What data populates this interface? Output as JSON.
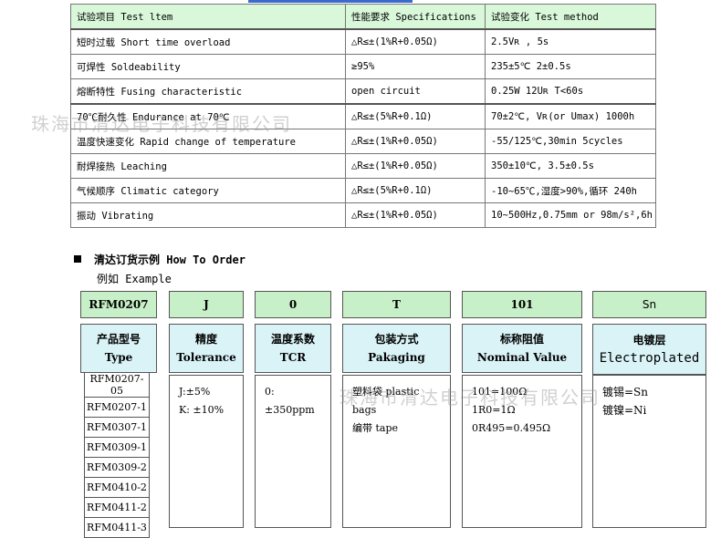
{
  "spec_table": {
    "header": [
      "试验项目 Test ltem",
      "性能要求 Specifications",
      "试验变化 Test method"
    ],
    "rows": [
      [
        "短时过载 Short time overload",
        "△R≤±(1%R+0.05Ω)",
        "2.5Vʀ ,    5s"
      ],
      [
        "可焊性 Soldeability",
        "≥95%",
        "235±5℃   2±0.5s"
      ],
      [
        "熔断特性 Fusing characteristic",
        "open circuit",
        "0.25W  12Uʀ  T<60s"
      ],
      [
        "70℃耐久性 Endurance at 70℃",
        "△R≤±(5%R+0.1Ω)",
        "70±2℃, Vʀ(or Umax) 1000h"
      ],
      [
        "温度快速变化 Rapid change of temperature",
        "△R≤±(1%R+0.05Ω)",
        "-55/125℃,30min 5cycles"
      ],
      [
        "耐焊接热 Leaching",
        "△R≤±(1%R+0.05Ω)",
        "350±10℃, 3.5±0.5s"
      ],
      [
        "气候顺序 Climatic category",
        "△R≤±(5%R+0.1Ω)",
        "-10~65℃,湿度>90%,循环 240h"
      ],
      [
        "振动 Vibrating",
        "△R≤±(1%R+0.05Ω)",
        "10~500Hz,0.75mm or 98m/s²,6h"
      ]
    ]
  },
  "watermarks": [
    "珠海市清达电子科技有限公司",
    "珠海市清达电子科技有限公司"
  ],
  "order": {
    "title": "清达订货示例 How To Order",
    "example_label": "例如 Example",
    "codes": [
      "RFM0207",
      "J",
      "0",
      "T",
      "101",
      "Sn"
    ],
    "categories": [
      {
        "cn": "产品型号",
        "en": "Type"
      },
      {
        "cn": "精度",
        "en": "Tolerance"
      },
      {
        "cn": "温度系数",
        "en": "TCR"
      },
      {
        "cn": "包装方式",
        "en": "Pakaging"
      },
      {
        "cn": "标称阻值",
        "en": "Nominal Value"
      },
      {
        "cn": "电镀层",
        "en": "Electroplated"
      }
    ],
    "models": [
      "RFM0207-05",
      "RFM0207-1",
      "RFM0307-1",
      "RFM0309-1",
      "RFM0309-2",
      "RFM0410-2",
      "RFM0411-2",
      "RFM0411-3"
    ],
    "tolerance": [
      "J:±5%",
      "K: ±10%"
    ],
    "tcr": [
      "0:±350ppm"
    ],
    "packaging": [
      "塑料袋 plastic bags",
      "编带 tape"
    ],
    "nominal": [
      "101=100Ω",
      "1R0=1Ω",
      "0R495=0.495Ω"
    ],
    "plating": [
      "镀锡=Sn",
      "镀镍=Ni"
    ]
  }
}
